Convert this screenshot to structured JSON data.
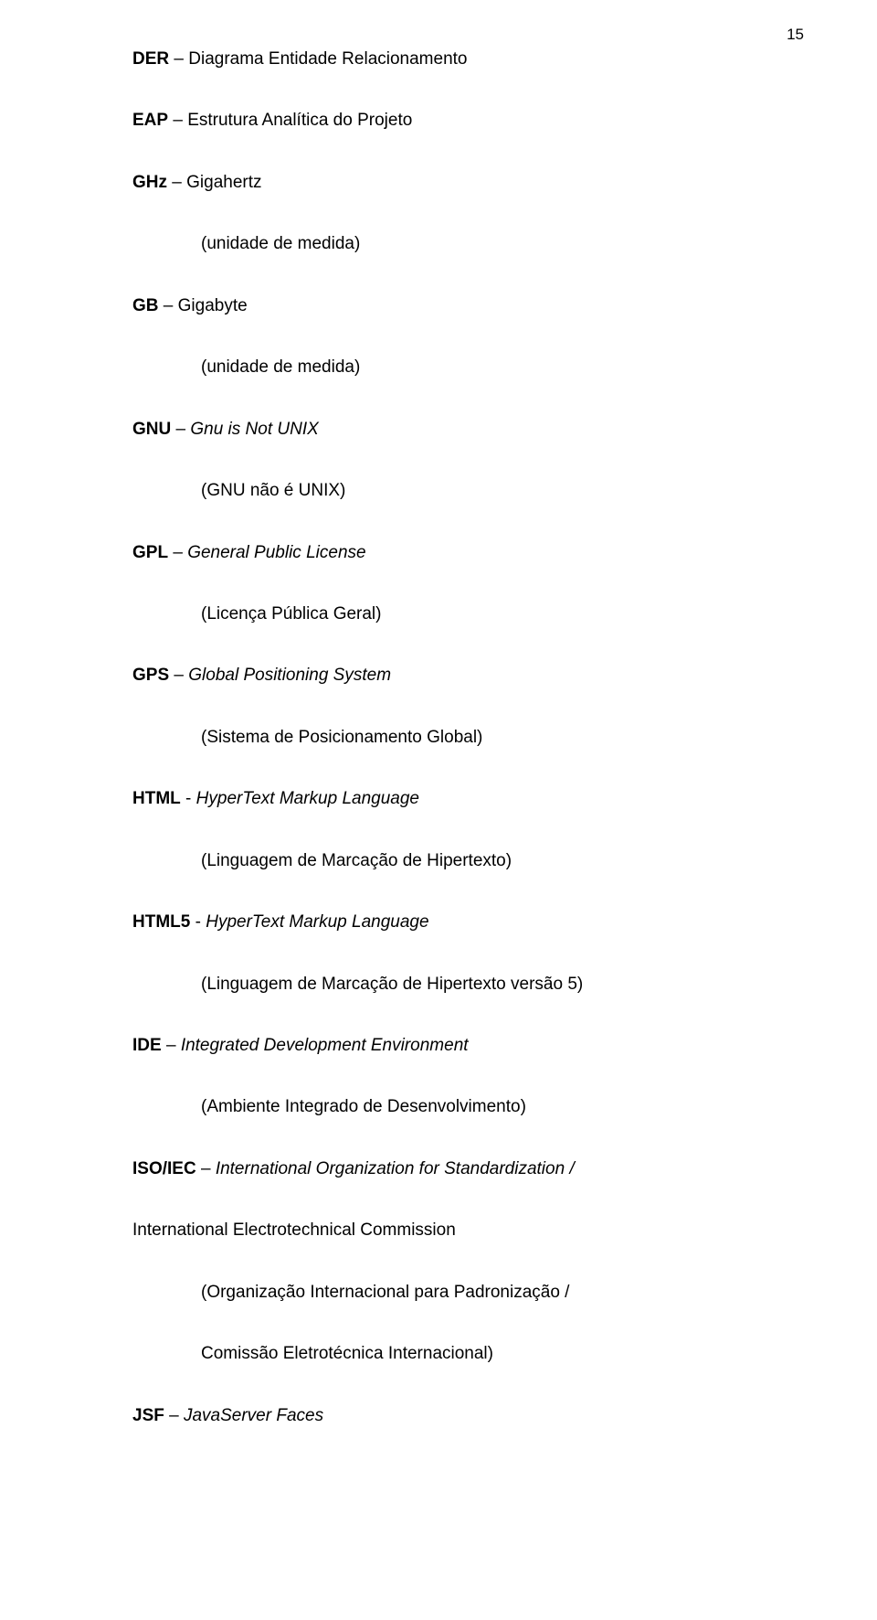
{
  "pageNumber": "15",
  "entries": [
    {
      "abbr": "DER",
      "sep": " – ",
      "full": "Diagrama Entidade Relacionamento",
      "fullItalic": false,
      "trans": null
    },
    {
      "abbr": "EAP",
      "sep": " – ",
      "full": "Estrutura Analítica do Projeto",
      "fullItalic": false,
      "trans": null
    },
    {
      "abbr": "GHz",
      "sep": " – ",
      "full": "Gigahertz",
      "fullItalic": false,
      "trans": "(unidade de medida)"
    },
    {
      "abbr": "GB",
      "sep": " – ",
      "full": "Gigabyte",
      "fullItalic": false,
      "trans": "(unidade de medida)"
    },
    {
      "abbr": "GNU",
      "sep": " – ",
      "full": "Gnu is Not UNIX",
      "fullItalic": true,
      "trans": "(GNU não é UNIX)"
    },
    {
      "abbr": "GPL",
      "sep": " – ",
      "full": "General Public License",
      "fullItalic": true,
      "trans": "(Licença Pública Geral)"
    },
    {
      "abbr": "GPS",
      "sep": " – ",
      "full": "Global Positioning System",
      "fullItalic": true,
      "trans": "(Sistema de Posicionamento Global)"
    },
    {
      "abbr": "HTML",
      "sep": " - ",
      "full": "HyperText Markup Language",
      "fullItalic": true,
      "trans": "(Linguagem de Marcação de Hipertexto)"
    },
    {
      "abbr": "HTML5",
      "sep": " - ",
      "full": "HyperText Markup Language",
      "fullItalic": true,
      "trans": "(Linguagem de Marcação de Hipertexto versão 5)"
    },
    {
      "abbr": "IDE",
      "sep": " – ",
      "full": "Integrated Development Environment",
      "fullItalic": true,
      "trans": "(Ambiente Integrado de Desenvolvimento)"
    }
  ],
  "isoiec": {
    "abbr": "ISO/IEC",
    "sep": " – ",
    "full1": "International Organization for Standardization / ",
    "full2": "International Electrotechnical Commission",
    "trans1": "(Organização Internacional para Padronização /",
    "trans2": "Comissão Eletrotécnica Internacional)"
  },
  "jsf": {
    "abbr": "JSF",
    "sep": " – ",
    "full": "JavaServer Faces"
  }
}
